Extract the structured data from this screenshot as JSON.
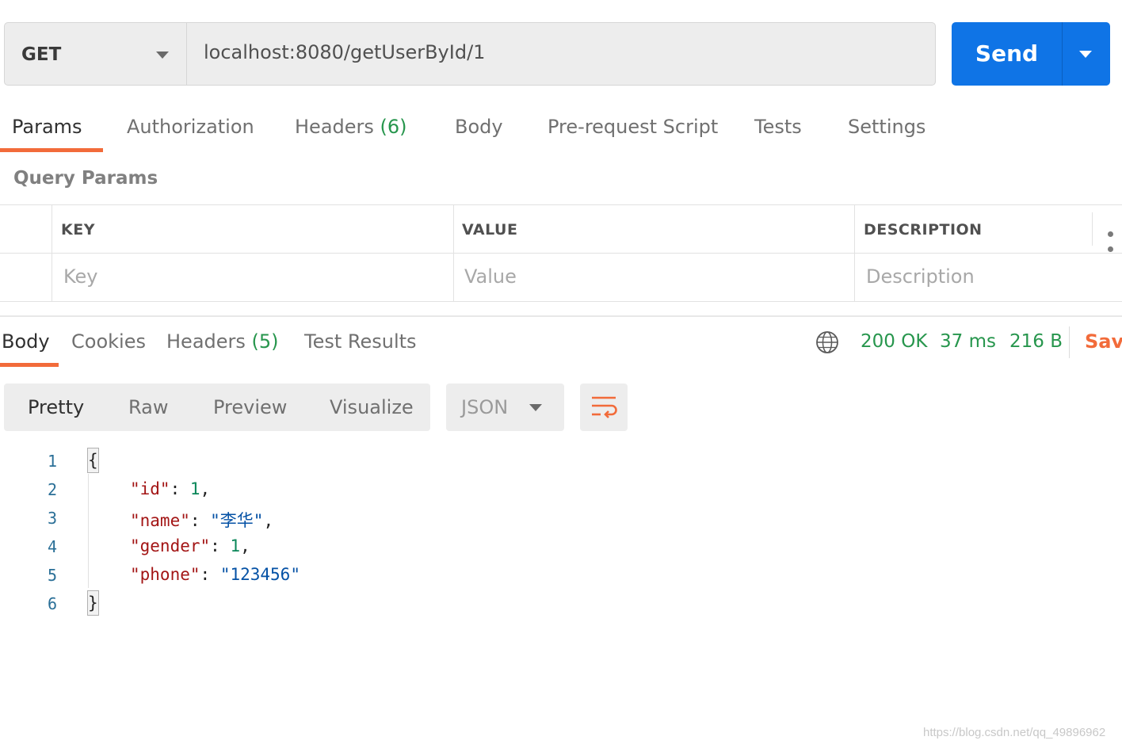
{
  "request": {
    "method": "GET",
    "url": "localhost:8080/getUserById/1",
    "send_label": "Send"
  },
  "request_tabs": {
    "params": "Params",
    "authorization": "Authorization",
    "headers": "Headers",
    "headers_count": "(6)",
    "body": "Body",
    "pre_request": "Pre-request Script",
    "tests": "Tests",
    "settings": "Settings",
    "active": "Params"
  },
  "query_params": {
    "title": "Query Params",
    "columns": [
      "KEY",
      "VALUE",
      "DESCRIPTION"
    ],
    "placeholders": {
      "key": "Key",
      "value": "Value",
      "description": "Description"
    }
  },
  "response_tabs": {
    "body": "Body",
    "cookies": "Cookies",
    "headers": "Headers",
    "headers_count": "(5)",
    "test_results": "Test Results",
    "active": "Body"
  },
  "response_meta": {
    "status": "200 OK",
    "time": "37 ms",
    "size": "216 B",
    "save_label": "Save",
    "icon": "globe-icon"
  },
  "view": {
    "modes": [
      "Pretty",
      "Raw",
      "Preview",
      "Visualize"
    ],
    "active_mode": "Pretty",
    "format": "JSON",
    "wrap_icon": "wrap-lines-icon"
  },
  "response_body": {
    "line_numbers": [
      "1",
      "2",
      "3",
      "4",
      "5",
      "6"
    ],
    "open_brace": "{",
    "close_brace": "}",
    "fields": [
      {
        "key": "\"id\"",
        "value": "1",
        "type": "number",
        "comma": ","
      },
      {
        "key": "\"name\"",
        "value": "\"李华\"",
        "type": "string",
        "comma": ","
      },
      {
        "key": "\"gender\"",
        "value": "1",
        "type": "number",
        "comma": ","
      },
      {
        "key": "\"phone\"",
        "value": "\"123456\"",
        "type": "string",
        "comma": ""
      }
    ]
  },
  "watermark": "https://blog.csdn.net/qq_49896962",
  "colors": {
    "accent": "#f26b3a",
    "send": "#0f74e6",
    "status_green": "#27964d",
    "json_key": "#a31515",
    "json_number": "#098658",
    "json_string": "#0451a5"
  }
}
